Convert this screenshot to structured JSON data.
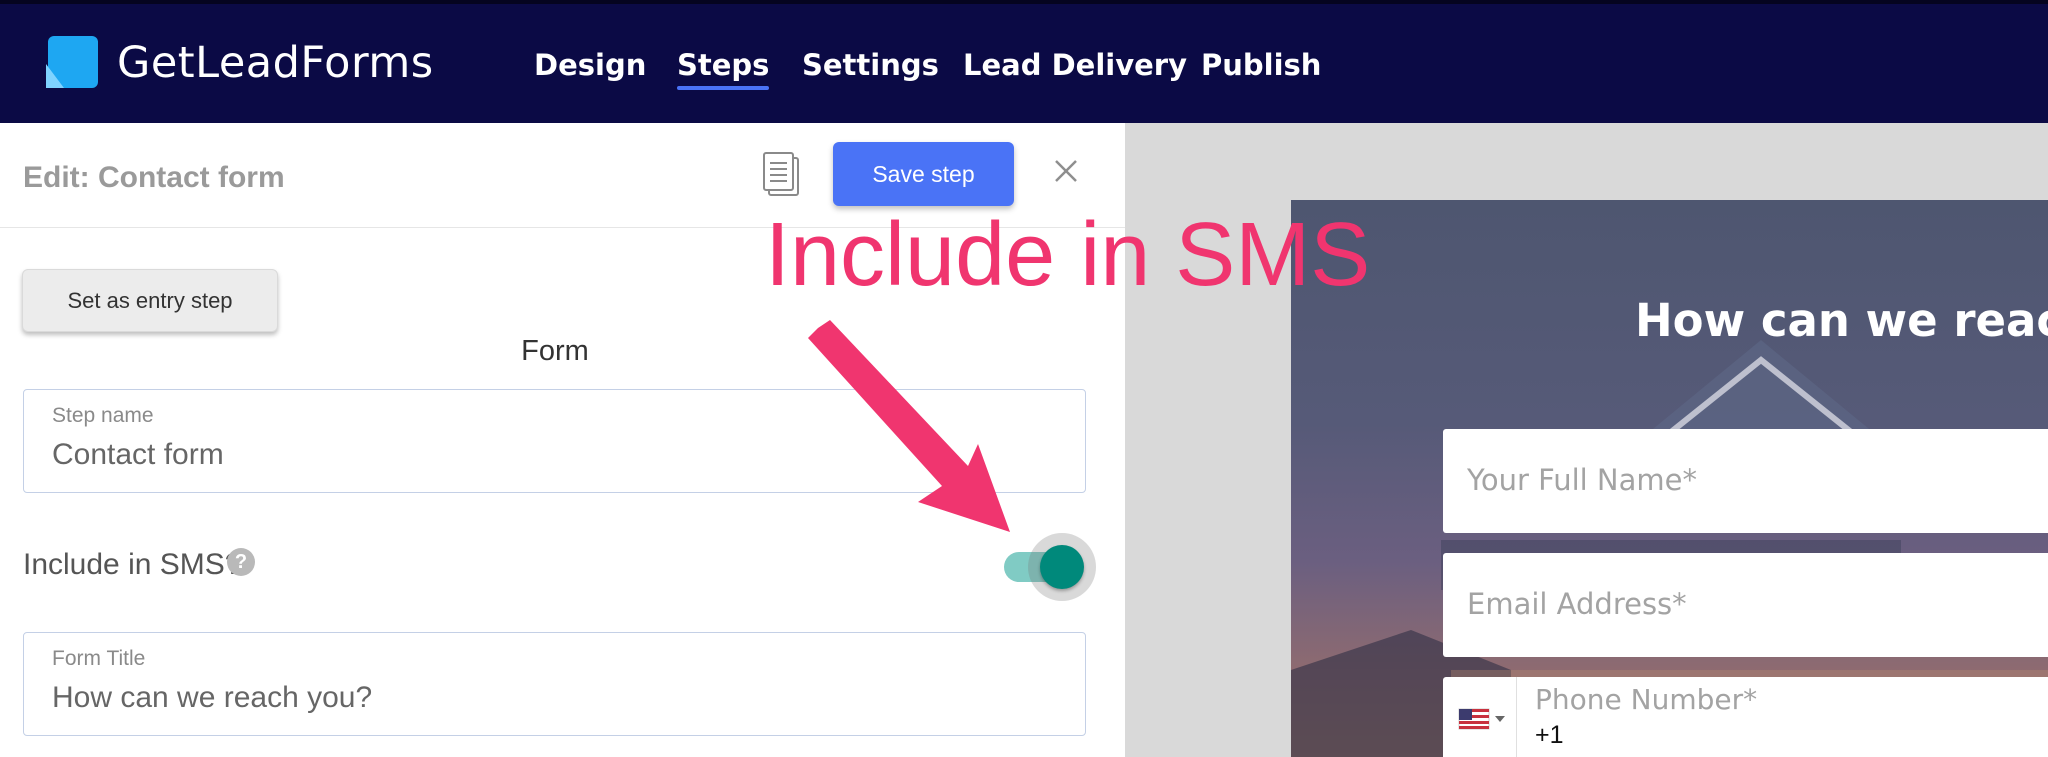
{
  "app": {
    "brand": "GetLeadForms"
  },
  "nav": {
    "items": [
      {
        "label": "Design",
        "active": false
      },
      {
        "label": "Steps",
        "active": true
      },
      {
        "label": "Settings",
        "active": false
      },
      {
        "label": "Lead Delivery",
        "active": false
      },
      {
        "label": "Publish",
        "active": false
      }
    ]
  },
  "editor": {
    "title": "Edit: Contact form",
    "save_label": "Save step",
    "entry_button": "Set as entry step",
    "section_label": "Form",
    "step_name": {
      "label": "Step name",
      "value": "Contact form"
    },
    "sms": {
      "label": "Include in SMS?",
      "help": "?",
      "enabled": true
    },
    "form_title": {
      "label": "Form Title",
      "value": "How can we reach you?"
    }
  },
  "preview": {
    "title": "How can we reach",
    "fields": {
      "full_name_placeholder": "Your Full Name*",
      "email_placeholder": "Email Address*",
      "phone_placeholder": "Phone Number*",
      "phone_value": "+1"
    }
  },
  "annotation": {
    "text": "Include in SMS"
  },
  "colors": {
    "nav_bg": "#0b0a45",
    "accent": "#4a73f6",
    "toggle": "#00897b",
    "annotation": "#f0356f"
  }
}
